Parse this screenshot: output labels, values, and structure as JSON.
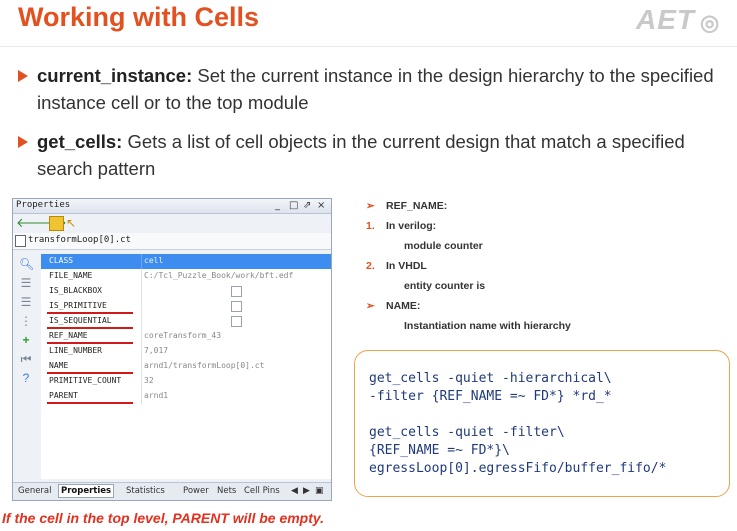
{
  "slide": {
    "title": "Working with Cells",
    "logo": "AET",
    "bullets": [
      {
        "term": "current_instance:",
        "text": " Set the current instance in the design hierarchy to the specified instance cell or to the top module"
      },
      {
        "term": "get_cells:",
        "text": " Gets a list of cell objects in the current design that match a specified search pattern"
      }
    ],
    "footer": "If the cell in the top level, PARENT will be empty."
  },
  "panel": {
    "title": "Properties",
    "window_buttons": [
      "_",
      "□",
      "⇗",
      "×"
    ],
    "object": "transformLoop[0].ct",
    "rows": [
      {
        "key": "CLASS",
        "value": "cell",
        "selected": true
      },
      {
        "key": "FILE_NAME",
        "value": "C:/Tcl_Puzzle_Book/work/bft.edf"
      },
      {
        "key": "IS_BLACKBOX",
        "value": "",
        "checkbox": true
      },
      {
        "key": "IS_PRIMITIVE",
        "value": "",
        "checkbox": true
      },
      {
        "key": "IS_SEQUENTIAL",
        "value": "",
        "checkbox": true
      },
      {
        "key": "REF_NAME",
        "value": "coreTransform_43"
      },
      {
        "key": "LINE_NUMBER",
        "value": "7,017"
      },
      {
        "key": "NAME",
        "value": "arnd1/transformLoop[0].ct"
      },
      {
        "key": "PRIMITIVE_COUNT",
        "value": "32"
      },
      {
        "key": "PARENT",
        "value": "arnd1"
      }
    ],
    "tabs": [
      "General",
      "Properties",
      "Statistics",
      "Power",
      "Nets",
      "Cell Pins"
    ],
    "active_tab": "Properties"
  },
  "notes": {
    "ref_name": "REF_NAME:",
    "n1": "In verilog:",
    "n1_detail": "module counter",
    "n2": "In VHDL",
    "n2_detail": "entity counter is",
    "name": "NAME:",
    "name_detail": "Instantiation  name with hierarchy",
    "num1": "1.",
    "num2": "2."
  },
  "code": {
    "lines": [
      "get_cells -quiet -hierarchical\\",
      "-filter {REF_NAME =~ FD*} *rd_*",
      "",
      "get_cells -quiet -filter\\",
      "{REF_NAME =~ FD*}\\",
      "egressLoop[0].egressFifo/buffer_fifo/*"
    ]
  },
  "colors": {
    "accent": "#e2511f",
    "selection": "#3d8cf0",
    "underline": "#d11a1a",
    "code": "#203a7a",
    "box_border": "#f0a24a"
  }
}
